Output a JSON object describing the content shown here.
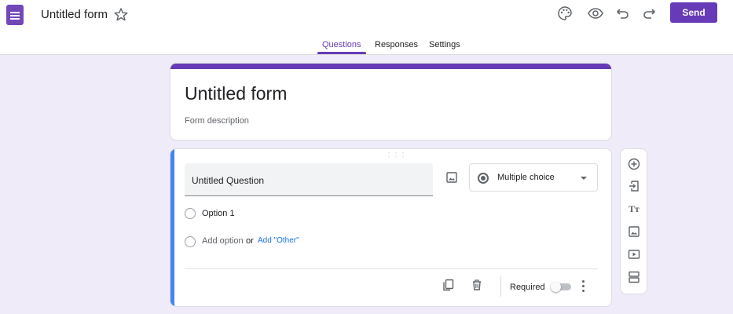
{
  "header": {
    "app_icon": "forms-logo-icon",
    "doc_title": "Untitled form",
    "icons": [
      "star-icon",
      "palette-icon",
      "eye-icon",
      "undo-icon",
      "redo-icon"
    ],
    "send_label": "Send"
  },
  "tabs": [
    {
      "label": "Questions",
      "active": true
    },
    {
      "label": "Responses",
      "active": false
    },
    {
      "label": "Settings",
      "active": false
    }
  ],
  "form": {
    "title": "Untitled form",
    "description_placeholder": "Form description"
  },
  "question": {
    "title": "Untitled Question",
    "type": "Multiple choice",
    "options": [
      "Option 1"
    ],
    "add_option_label": "Add option",
    "or_label": "or",
    "add_other_label": "Add \"Other\"",
    "required_label": "Required",
    "required": false
  },
  "side_toolbar": {
    "icons": [
      "add-question-icon",
      "import-questions-icon",
      "add-title-icon",
      "add-image-icon",
      "add-video-icon",
      "add-section-icon"
    ]
  },
  "colors": {
    "brand": "#673ab7",
    "background": "#f0ebf8",
    "active_accent": "#4285f4",
    "link": "#1a73e8"
  }
}
